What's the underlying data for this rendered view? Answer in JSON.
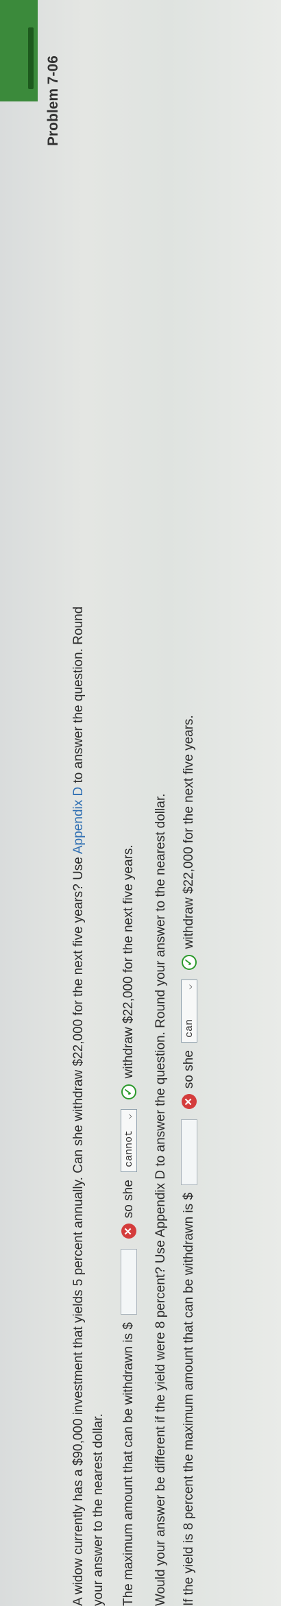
{
  "problem": {
    "title": "Problem 7-06",
    "intro_part1": "A widow currently has a $90,000 investment that yields 5 percent annually. Can she withdraw $22,000 for the next five years? Use ",
    "intro_link": "Appendix D",
    "intro_part2": " to answer the question. Round",
    "intro_line2": "your answer to the nearest dollar."
  },
  "q1": {
    "prefix": "The maximum amount that can be withdrawn is $",
    "answer_value": "",
    "so_she": "so she",
    "select_value": "cannot",
    "suffix": "withdraw $22,000 for the next five years."
  },
  "q2": {
    "line1": "Would your answer be different if the yield were 8 percent? Use Appendix D to answer the question. Round your answer to the nearest dollar.",
    "prefix": "If the yield is 8 percent the maximum amount that can be withdrawn is $",
    "answer_value": "",
    "so_she": "so she",
    "select_value": "can",
    "suffix": "withdraw $22,000 for the next five years."
  },
  "icons": {
    "wrong_icon": "✕",
    "correct_icon": "✓",
    "chevron": "❯"
  }
}
